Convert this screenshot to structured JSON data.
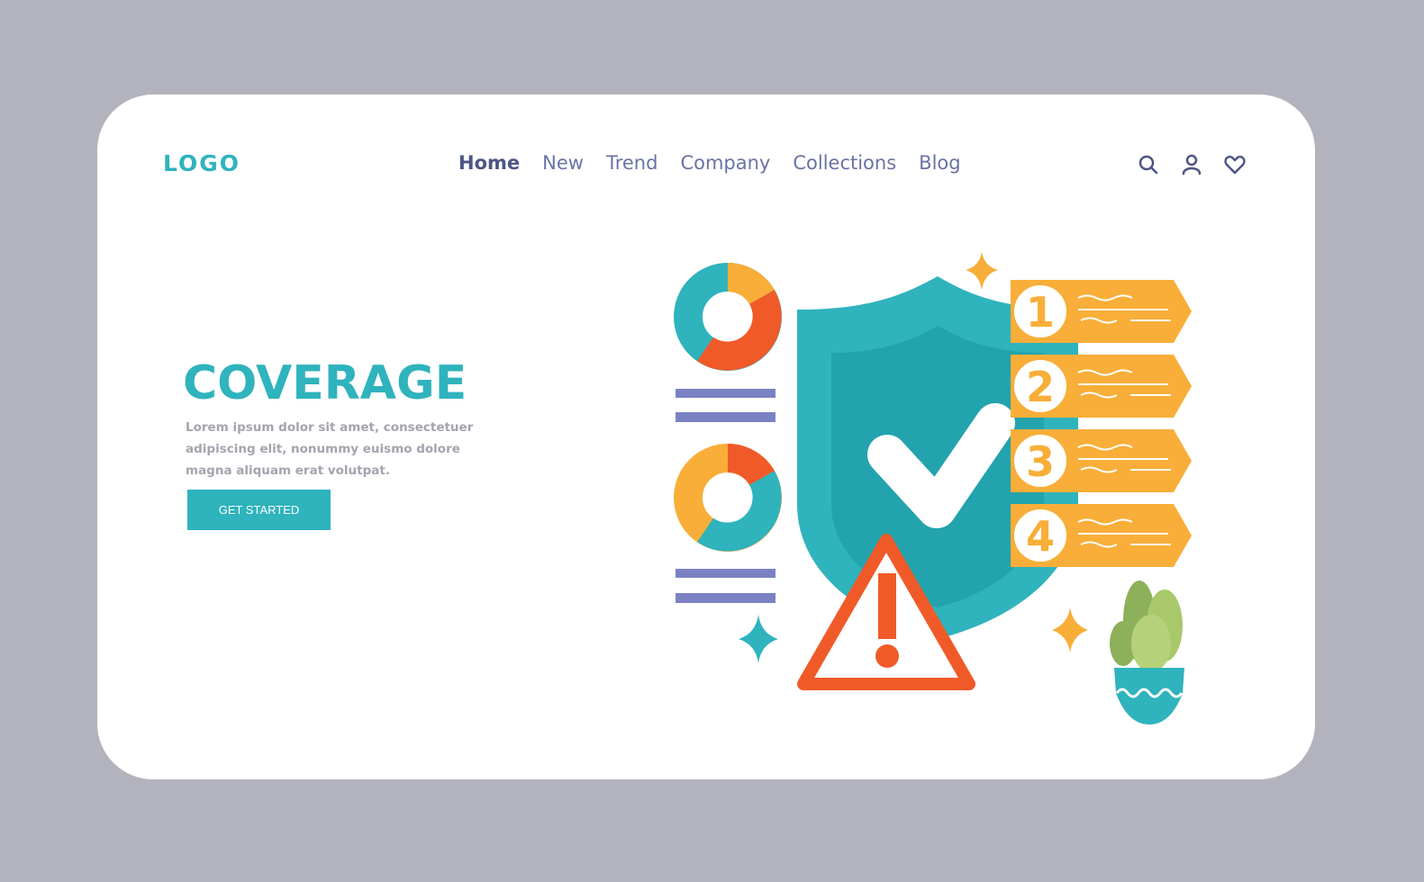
{
  "header": {
    "logo": "LOGO",
    "nav": [
      {
        "label": "Home",
        "active": true
      },
      {
        "label": "New"
      },
      {
        "label": "Trend"
      },
      {
        "label": "Company"
      },
      {
        "label": "Collections"
      },
      {
        "label": "Blog"
      }
    ],
    "icons": [
      "search-icon",
      "user-icon",
      "heart-icon"
    ]
  },
  "hero": {
    "title": "COVERAGE",
    "description": "Lorem ipsum dolor sit amet, consectetuer adipiscing elit, nonummy euismo dolore magna aliquam erat volutpat.",
    "cta_label": "GET STARTED"
  },
  "illustration": {
    "steps": [
      "1",
      "2",
      "3",
      "4"
    ],
    "colors": {
      "teal": "#2fb3bd",
      "teal_dark": "#22a3ad",
      "orange": "#f8ae38",
      "red": "#f05a28",
      "lavender": "#7b82c4",
      "green": "#8db05a"
    }
  }
}
